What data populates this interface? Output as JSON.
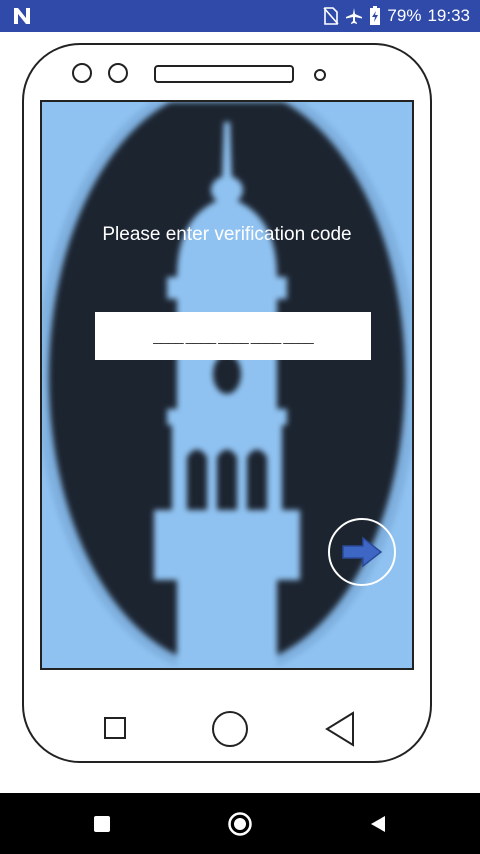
{
  "status_bar": {
    "left_icon": "n-notification-icon",
    "battery_percent": "79%",
    "time": "19:33",
    "icons": [
      "no-sim-icon",
      "airplane-icon",
      "battery-icon"
    ]
  },
  "screen": {
    "title": "Please enter verification code",
    "code_input": {
      "placeholder": "____ ____ ____ ____ ____",
      "value": ""
    },
    "next_icon": "arrow-right-icon",
    "background_art": "minaret-image"
  },
  "phone_frame": {
    "nav_icons": [
      "square-icon",
      "circle-icon",
      "triangle-back-icon"
    ]
  },
  "android_nav": {
    "icons": [
      "recents-icon",
      "home-icon",
      "back-icon"
    ]
  },
  "colors": {
    "status_bar": "#2f4aa8",
    "screen_dark": "#1c2430",
    "screen_light": "#8fc2f1",
    "arrow": "#3e66c4"
  }
}
